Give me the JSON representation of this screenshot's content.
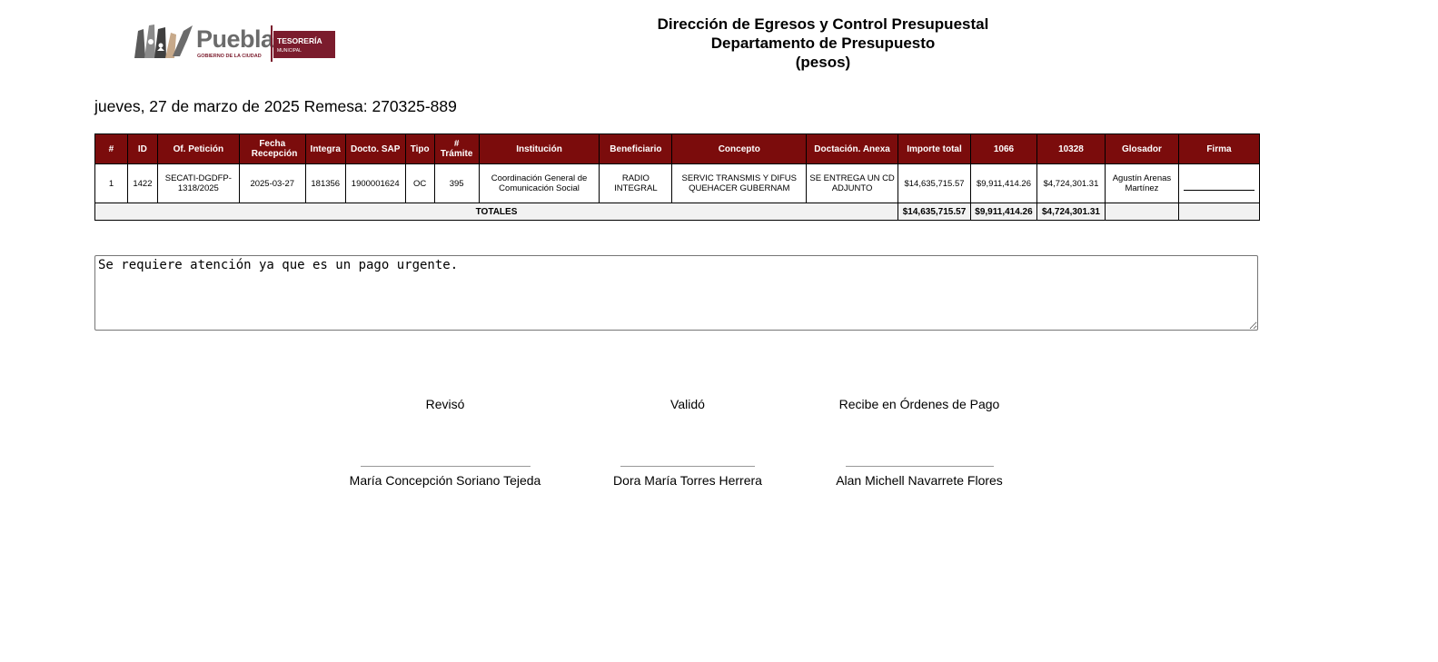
{
  "logo": {
    "brand": "Puebla",
    "tagline": "GOBIERNO DE LA CIUDAD",
    "unit": "TESORERÍA",
    "unit_sub": "MUNICIPAL"
  },
  "header": {
    "line1": "Dirección de Egresos y Control Presupuestal",
    "line2": "Departamento de Presupuesto",
    "line3": "(pesos)"
  },
  "date_line": "jueves, 27 de marzo de 2025 Remesa: 270325-889",
  "table": {
    "columns": [
      "#",
      "ID",
      "Of. Petición",
      "Fecha Recepción",
      "Integra",
      "Docto. SAP",
      "Tipo",
      "# Trámite",
      "Institución",
      "Beneficiario",
      "Concepto",
      "Doctación. Anexa",
      "Importe total",
      "1066",
      "10328",
      "Glosador",
      "Firma"
    ],
    "rows": [
      {
        "num": "1",
        "id": "1422",
        "of_peticion": "SECATI-DGDFP-1318/2025",
        "fecha": "2025-03-27",
        "integra": "181356",
        "docto_sap": "1900001624",
        "tipo": "OC",
        "tramite": "395",
        "institucion": "Coordinación General de Comunicación Social",
        "beneficiario": "RADIO INTEGRAL",
        "concepto": "SERVIC TRANSMIS Y DIFUS QUEHACER GUBERNAM",
        "doctacion": "SE ENTREGA UN CD ADJUNTO",
        "importe_total": "$14,635,715.57",
        "c1066": "$9,911,414.26",
        "c10328": "$4,724,301.31",
        "glosador": "Agustín Arenas Martínez"
      }
    ],
    "totals": {
      "label": "TOTALES",
      "importe_total": "$14,635,715.57",
      "c1066": "$9,911,414.26",
      "c10328": "$4,724,301.31"
    }
  },
  "notes": {
    "value": "Se requiere atención ya que es un pago urgente."
  },
  "signatures": [
    {
      "label": "Revisó",
      "name": "María Concepción Soriano Tejeda"
    },
    {
      "label": "Validó",
      "name": "Dora María Torres Herrera"
    },
    {
      "label": "Recibe en Órdenes de Pago",
      "name": "Alan Michell Navarrete Flores"
    }
  ],
  "colors": {
    "header_bg": "#7b0c0c",
    "brand": "#7b1c2d"
  }
}
